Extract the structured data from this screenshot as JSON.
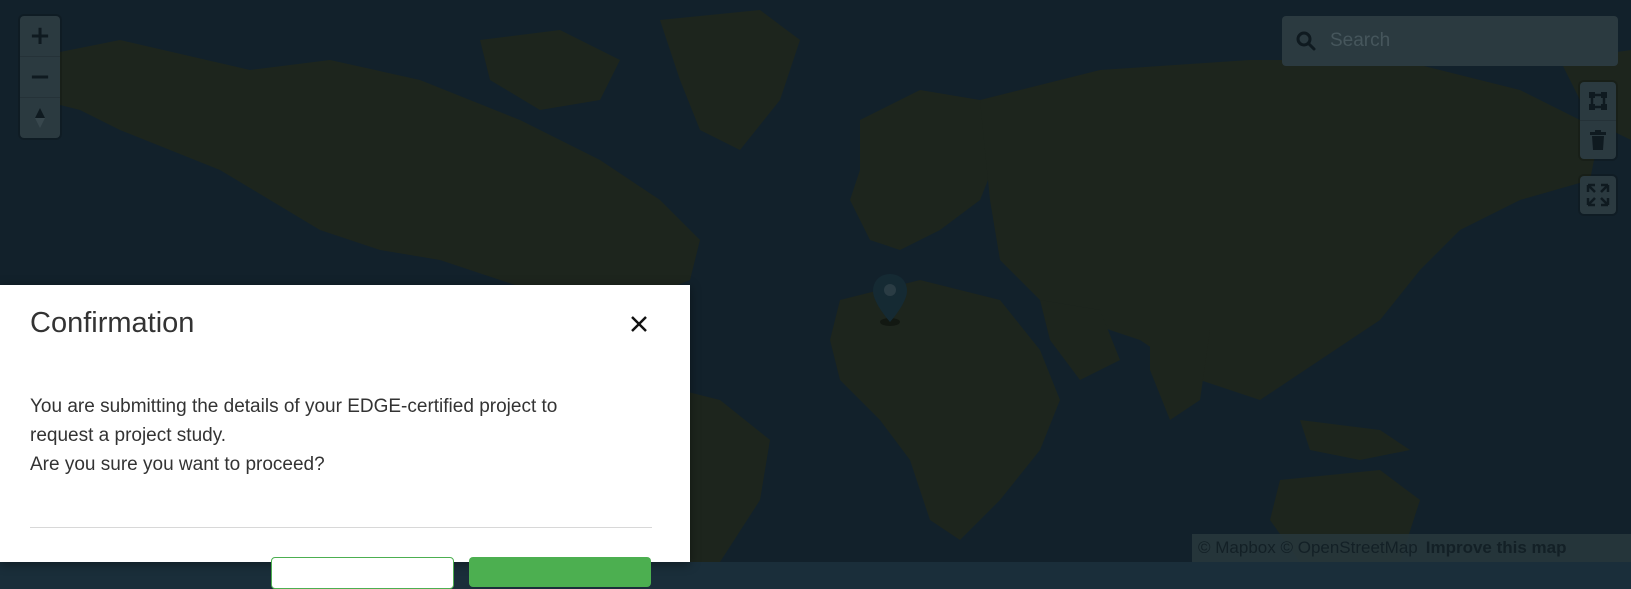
{
  "map": {
    "search": {
      "placeholder": "Search",
      "icon": "search-icon"
    },
    "zoom_controls": {
      "zoom_in_label": "+",
      "zoom_out_label": "−",
      "compass_icon": "compass-icon"
    },
    "draw_controls": {
      "polygon_icon": "polygon-draw-icon",
      "trash_icon": "trash-icon"
    },
    "fullscreen_icon": "fullscreen-icon",
    "marker_icon": "map-pin-icon",
    "attribution": {
      "mapbox": "© Mapbox",
      "osm": "© OpenStreetMap",
      "improve": "Improve this map"
    }
  },
  "dialog": {
    "title": "Confirmation",
    "close_icon": "close-icon",
    "body_line_1": "You are submitting the details of your EDGE-certified project to request a project study.",
    "body_line_2": "Are you sure you want to proceed?",
    "accent_color": "#4caf50"
  }
}
